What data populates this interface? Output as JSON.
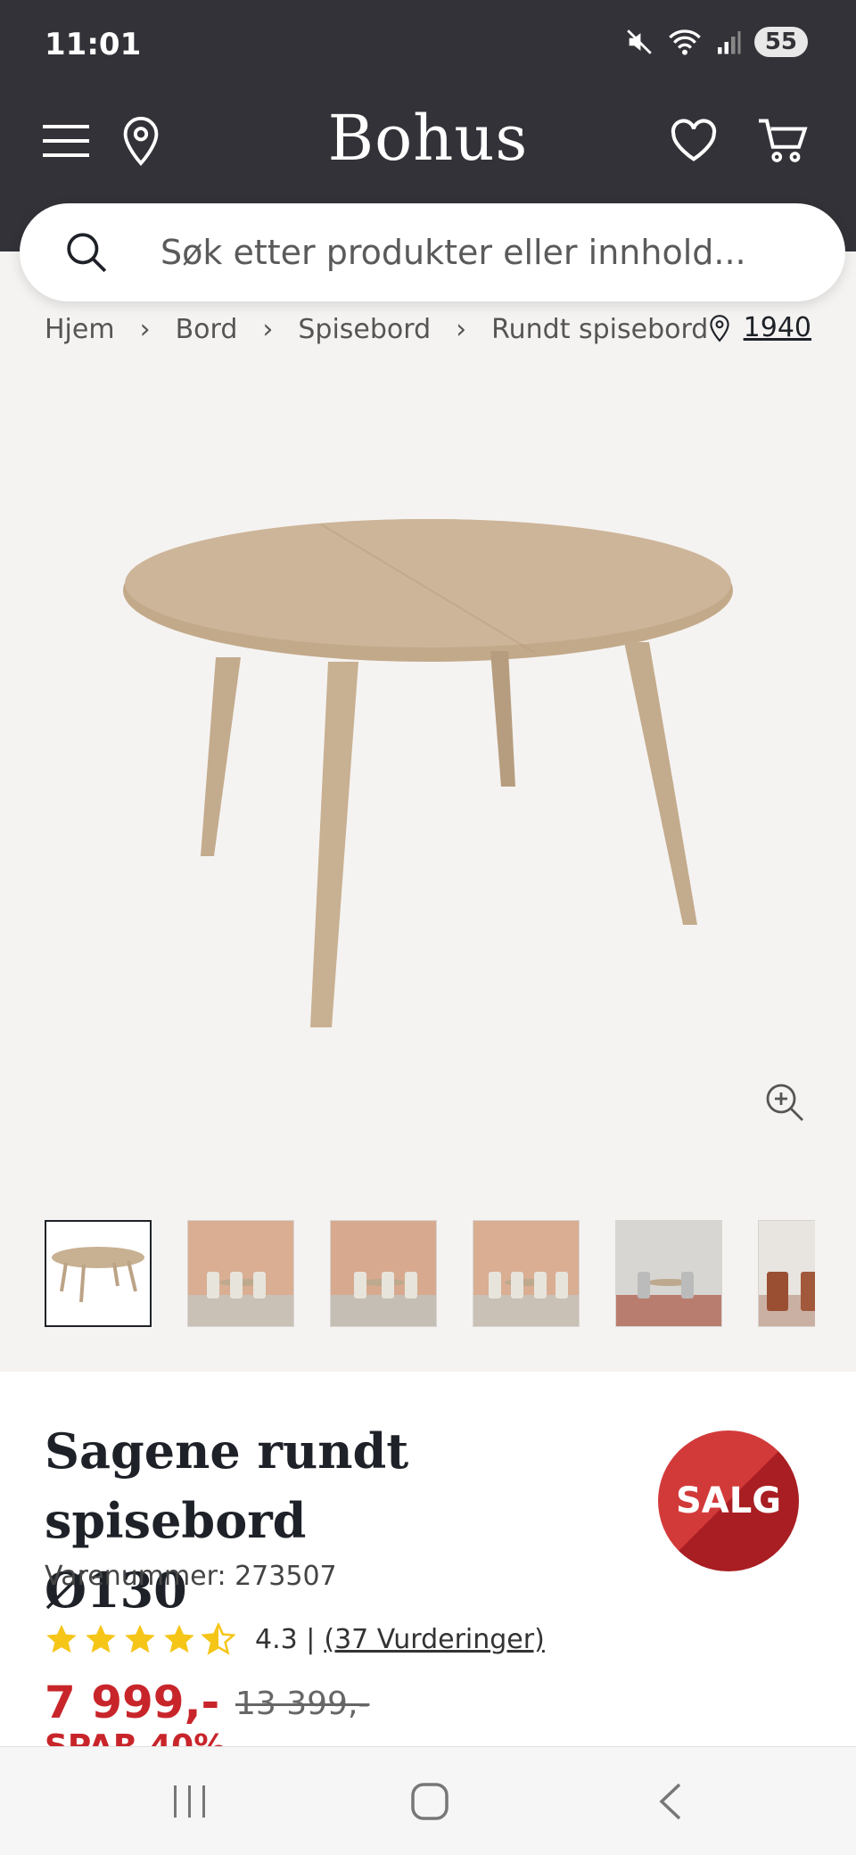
{
  "status_bar": {
    "time": "11:01",
    "battery": "55",
    "icons": [
      "mute-icon",
      "wifi-icon",
      "signal-icon"
    ]
  },
  "header": {
    "logo": "Bohus",
    "icons": [
      "menu-icon",
      "location-icon",
      "heart-icon",
      "cart-icon"
    ]
  },
  "search": {
    "placeholder": "Søk etter produkter eller innhold..."
  },
  "breadcrumb": {
    "items": [
      "Hjem",
      "Bord",
      "Spisebord",
      "Rundt spisebord"
    ],
    "store": "1940"
  },
  "product": {
    "title_line1": "Sagene rundt spisebord",
    "title_line2": "Ø130",
    "sku": "Varenummer: 273507",
    "rating_value": 4.3,
    "rating_text": "4.3 |",
    "reviews": "(37 Vurderinger)",
    "price": "7 999,-",
    "old_price": "13 399,-",
    "save_text": "SPAR 40%",
    "badge": "SALG"
  },
  "colors": {
    "header_bg": "#323238",
    "accent_red": "#c8252b",
    "star": "#f5c518",
    "gallery_bg": "#f5f3f1"
  },
  "thumbnails_count": 6
}
